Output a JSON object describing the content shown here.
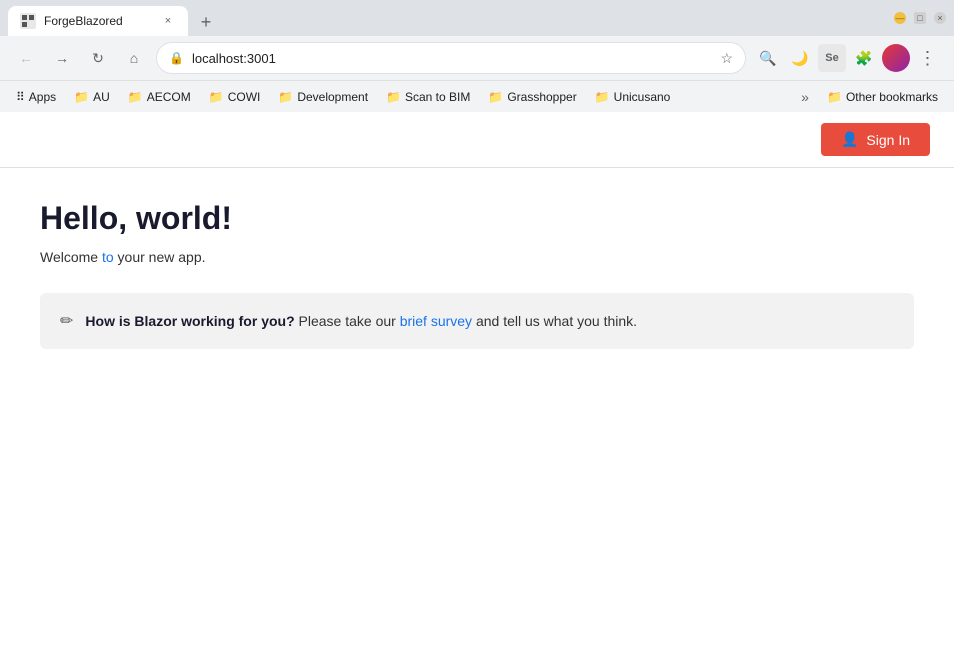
{
  "browser": {
    "tab_title": "ForgeBlazored",
    "tab_close_label": "×",
    "new_tab_label": "+",
    "window_controls": {
      "minimize": "—",
      "maximize": "□",
      "close": "×"
    }
  },
  "toolbar": {
    "back_label": "←",
    "forward_label": "→",
    "refresh_label": "↻",
    "home_label": "⌂",
    "address": "localhost:3001",
    "star_label": "☆"
  },
  "bookmarks": {
    "items": [
      {
        "id": "apps",
        "label": "Apps",
        "icon": "⠿"
      },
      {
        "id": "au",
        "label": "AU",
        "icon": "📁"
      },
      {
        "id": "aecom",
        "label": "AECOM",
        "icon": "📁"
      },
      {
        "id": "cowi",
        "label": "COWI",
        "icon": "📁"
      },
      {
        "id": "development",
        "label": "Development",
        "icon": "📁"
      },
      {
        "id": "scan-to-bim",
        "label": "Scan to BIM",
        "icon": "📁"
      },
      {
        "id": "grasshopper",
        "label": "Grasshopper",
        "icon": "📁"
      },
      {
        "id": "unicusano",
        "label": "Unicusano",
        "icon": "📁"
      }
    ],
    "more_label": "»",
    "other_bookmarks_icon": "📁",
    "other_bookmarks_label": "Other bookmarks"
  },
  "page": {
    "sign_in_label": "Sign In",
    "heading": "Hello, world!",
    "subtext_prefix": "Welcome ",
    "subtext_link": "to",
    "subtext_suffix": " your new app.",
    "survey": {
      "icon": "✏",
      "bold_text": "How is Blazor working for you?",
      "text": " Please take our ",
      "link_text": "brief survey",
      "text_suffix": " and tell us what you think."
    }
  },
  "icons": {
    "lock": "🔒",
    "search": "🔍",
    "extension": "🧩",
    "moon": "🌙",
    "selenium": "Se"
  }
}
